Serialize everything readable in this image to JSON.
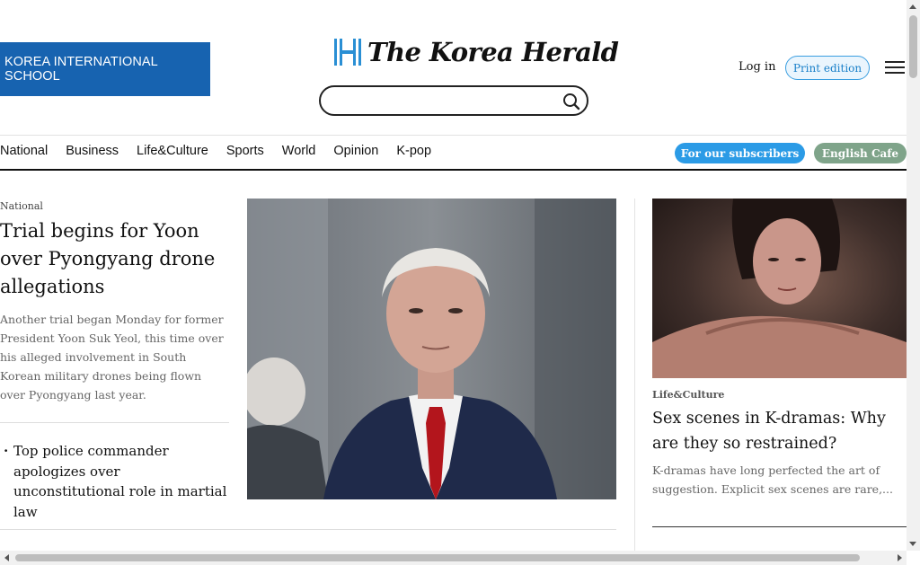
{
  "header": {
    "ad_banner_text": "KOREA INTERNATIONAL SCHOOL",
    "logo_text": "The Korea Herald",
    "search_placeholder": "",
    "login_label": "Log in",
    "print_edition_label": "Print edition",
    "brand_blue": "#1763b0",
    "accent_blue": "#2b9be6"
  },
  "nav": {
    "items": [
      "National",
      "Business",
      "Life&Culture",
      "Sports",
      "World",
      "Opinion",
      "K-pop"
    ],
    "subscribers_label": "For our subscribers",
    "english_cafe_label": "English Cafe",
    "cafe_color": "#7fa48a"
  },
  "lead": {
    "kicker": "National",
    "title": "Trial begins for Yoon over Pyongyang drone allegations",
    "summary": "Another trial began Monday for former President Yoon Suk Yeol, this time over his alleged involvement in South Korean military drones being flown over Pyongyang last year.",
    "related": "Top police commander apologizes over unconstitutional role in martial law",
    "image_icon": "news-photo-icon"
  },
  "side": {
    "kicker": "Life&Culture",
    "title": "Sex scenes in K-dramas: Why are they so restrained?",
    "summary": "K-dramas have long perfected the art of suggestion. Explicit sex scenes are rare,...",
    "image_icon": "drama-still-icon"
  }
}
